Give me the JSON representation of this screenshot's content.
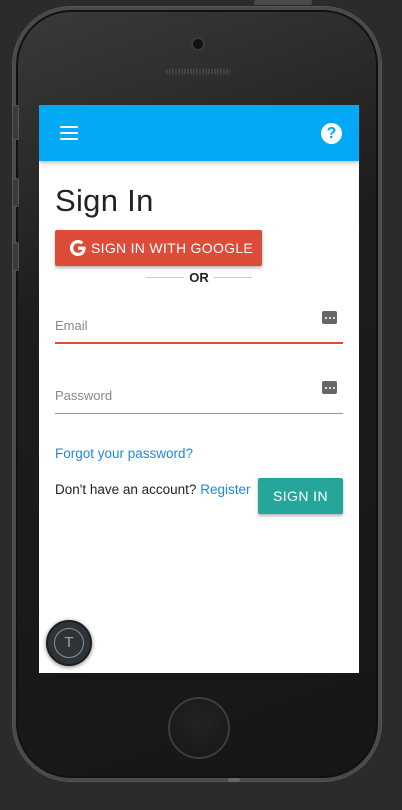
{
  "app": {
    "title": "Sign In",
    "appbar_color": "#03a9f4"
  },
  "header": {
    "menu_icon": "hamburger-menu-icon",
    "help_icon": "help-icon",
    "help_glyph": "?"
  },
  "auth": {
    "google_button_label": "SIGN IN WITH GOOGLE",
    "google_color": "#dd4b39",
    "divider_text": "OR",
    "email_placeholder": "Email",
    "password_placeholder": "Password",
    "forgot_password": "Forgot your password?",
    "no_account_text": "Don't have an account?",
    "register_link": "Register",
    "signin_button_label": "SIGN IN",
    "signin_color": "#26a69a"
  },
  "fab": {
    "avatar_letter": "T"
  }
}
